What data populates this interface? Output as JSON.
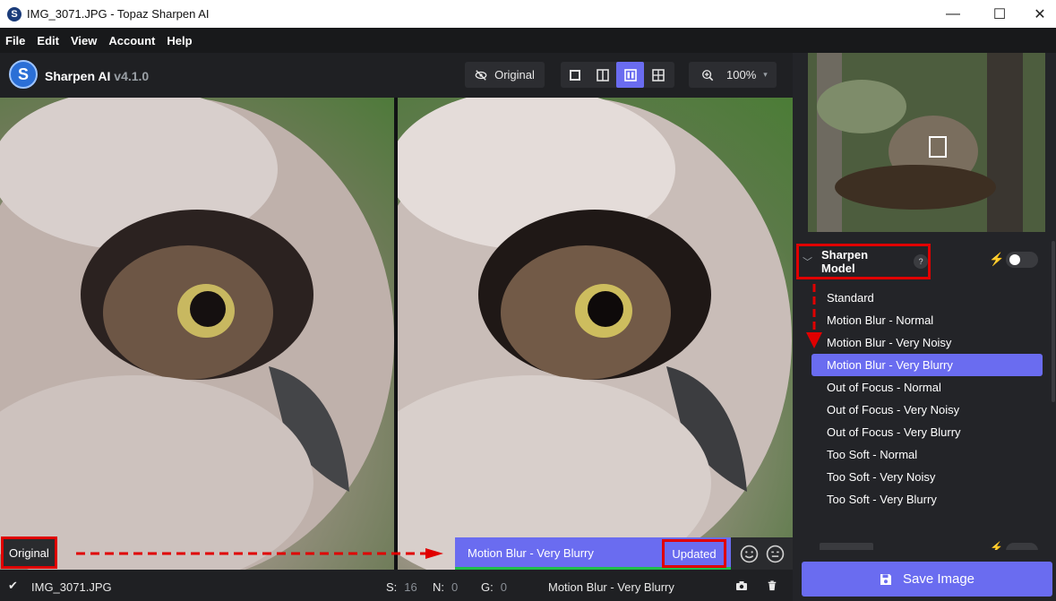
{
  "window": {
    "title": "IMG_3071.JPG - Topaz Sharpen AI",
    "minimize_glyph": "—",
    "maximize_glyph": "☐",
    "close_glyph": "✕"
  },
  "menu": [
    "File",
    "Edit",
    "View",
    "Account",
    "Help"
  ],
  "brand": {
    "name": "Sharpen AI",
    "version": "v4.1.0",
    "logo_letter": "S"
  },
  "toolbar": {
    "original_label": "Original",
    "zoom_value": "100%"
  },
  "preview": {
    "left_label": "Original",
    "model_label": "Motion Blur - Very Blurry",
    "updated_label": "Updated"
  },
  "status": {
    "filename": "IMG_3071.JPG",
    "s_key": "S:",
    "s_value": "16",
    "n_key": "N:",
    "n_value": "0",
    "g_key": "G:",
    "g_value": "0",
    "model": "Motion Blur - Very Blurry"
  },
  "panel": {
    "section_title": "Sharpen Model",
    "help_glyph": "?",
    "models": [
      "Standard",
      "Motion Blur - Normal",
      "Motion Blur - Very Noisy",
      "Motion Blur - Very Blurry",
      "Out of Focus - Normal",
      "Out of Focus - Very Noisy",
      "Out of Focus - Very Blurry",
      "Too Soft - Normal",
      "Too Soft - Very Noisy",
      "Too Soft - Very Blurry"
    ],
    "selected_model": "Motion Blur - Very Blurry",
    "save_label": "Save Image"
  },
  "colors": {
    "accent": "#6a6cf0",
    "annotation_red": "#e00000",
    "progress_green": "#1fbf4a"
  },
  "icons": [
    "eye-slash-icon",
    "zoom-in-icon",
    "bolt-icon",
    "save-disk-icon",
    "camera-icon",
    "trash-icon",
    "smile-icon",
    "neutral-face-icon",
    "check-icon",
    "chevron-down-icon"
  ]
}
